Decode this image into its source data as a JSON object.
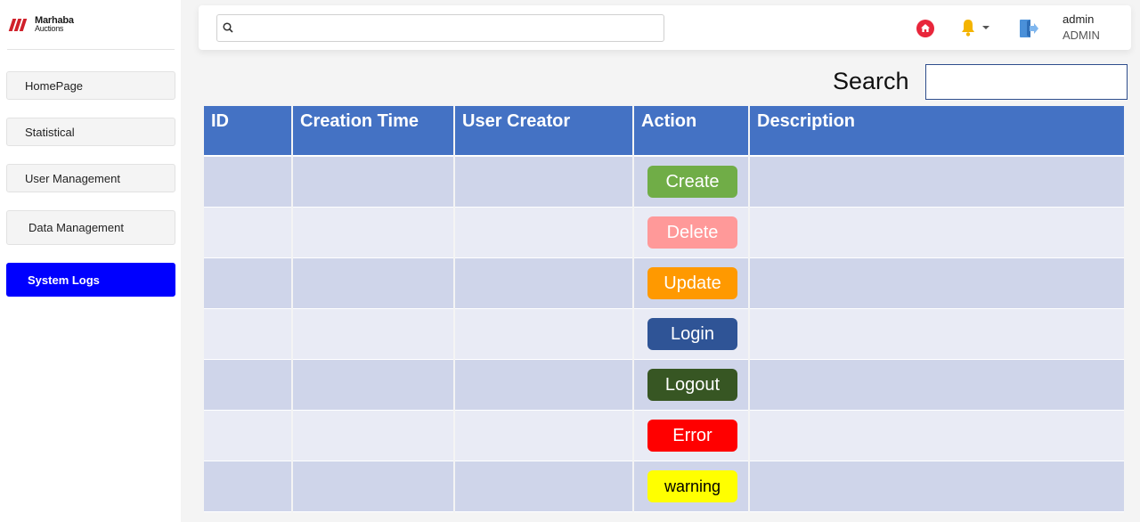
{
  "brand": {
    "line1": "Marhaba",
    "line2": "Auctions"
  },
  "sidebar": {
    "items": [
      {
        "label": "HomePage",
        "active": false
      },
      {
        "label": "Statistical",
        "active": false
      },
      {
        "label": "User Management",
        "active": false
      },
      {
        "label": "Data Management",
        "active": false
      },
      {
        "label": "System Logs",
        "active": true
      }
    ]
  },
  "topbar": {
    "search_value": "",
    "icons": [
      "search-icon",
      "home-icon",
      "bell-icon",
      "chevron-down-icon",
      "logout-icon"
    ],
    "user": {
      "name": "admin",
      "role": "ADMIN"
    }
  },
  "search": {
    "label": "Search",
    "value": ""
  },
  "table": {
    "columns": [
      "ID",
      "Creation Time",
      "User Creator",
      "Action",
      "Description"
    ],
    "rows": [
      {
        "id": "",
        "creation_time": "",
        "user_creator": "",
        "action": "Create",
        "description": ""
      },
      {
        "id": "",
        "creation_time": "",
        "user_creator": "",
        "action": "Delete",
        "description": ""
      },
      {
        "id": "",
        "creation_time": "",
        "user_creator": "",
        "action": "Update",
        "description": ""
      },
      {
        "id": "",
        "creation_time": "",
        "user_creator": "",
        "action": "Login",
        "description": ""
      },
      {
        "id": "",
        "creation_time": "",
        "user_creator": "",
        "action": "Logout",
        "description": ""
      },
      {
        "id": "",
        "creation_time": "",
        "user_creator": "",
        "action": "Error",
        "description": ""
      },
      {
        "id": "",
        "creation_time": "",
        "user_creator": "",
        "action": "warning",
        "description": ""
      }
    ]
  },
  "colors": {
    "header": "#4472c4",
    "row_odd": "#cfd5ea",
    "row_even": "#e9ebf5",
    "active_nav": "#0000ff",
    "action_create": "#70ad47",
    "action_delete": "#ff9999",
    "action_update": "#ff9900",
    "action_login": "#2f5496",
    "action_logout": "#375623",
    "action_error": "#ff0000",
    "action_warning": "#ffff00",
    "action_warning_text": "#000000"
  }
}
